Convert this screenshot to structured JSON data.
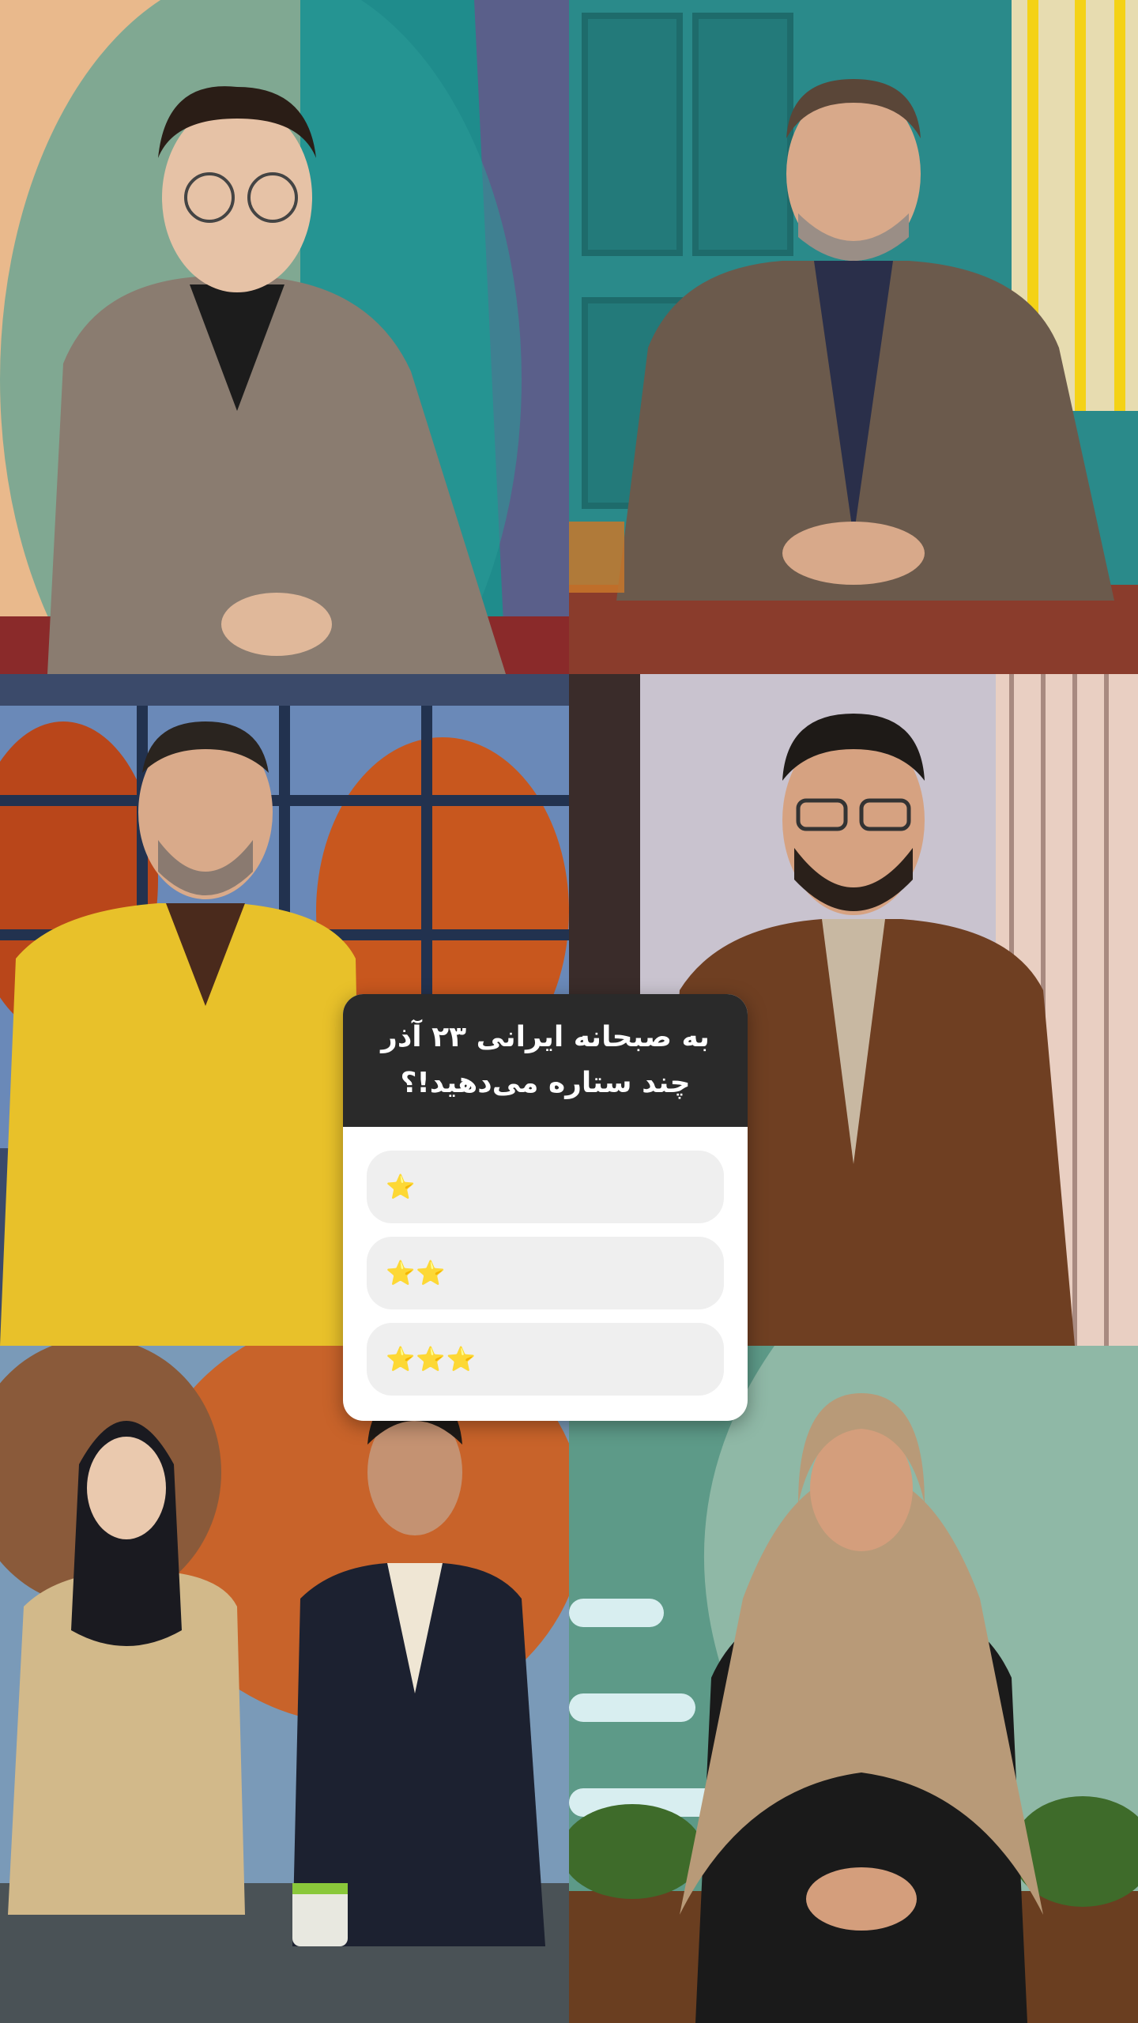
{
  "poll": {
    "question": "به صبحانه ایرانی ۲۳ آذر چند ستاره می‌دهید!؟",
    "options": [
      {
        "label": "⭐",
        "stars": 1
      },
      {
        "label": "⭐⭐",
        "stars": 2
      },
      {
        "label": "⭐⭐⭐",
        "stars": 3
      }
    ]
  },
  "colors": {
    "poll_header_bg": "#2a2a2a",
    "poll_option_bg": "#efefef",
    "star": "#f2b705"
  },
  "photos": [
    {
      "id": "guest-1",
      "jacket": "#8a7c70"
    },
    {
      "id": "guest-2",
      "jacket": "#6b5a4c"
    },
    {
      "id": "host-yellow-sweater",
      "jacket": "#e8c12a"
    },
    {
      "id": "host-leather-jacket",
      "jacket": "#6f3f22"
    },
    {
      "id": "guests-pair",
      "jacket": "#d2b98a"
    },
    {
      "id": "guest-hijab",
      "jacket": "#b89a78"
    }
  ]
}
